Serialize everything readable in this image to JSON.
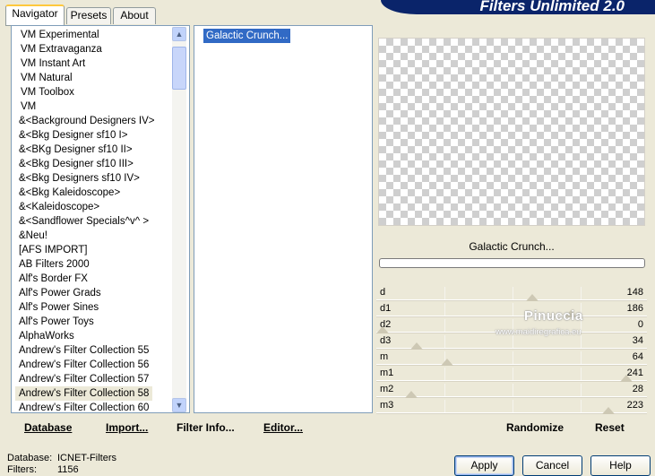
{
  "banner": {
    "title": "Filters Unlimited 2.0"
  },
  "tabs": [
    {
      "label": "Navigator",
      "active": true
    },
    {
      "label": "Presets",
      "active": false
    },
    {
      "label": "About",
      "active": false
    }
  ],
  "categories": [
    "VM Experimental",
    "VM Extravaganza",
    "VM Instant Art",
    "VM Natural",
    "VM Toolbox",
    "VM",
    "&<Background Designers IV>",
    "&<Bkg Designer sf10 I>",
    "&<BKg Designer sf10 II>",
    "&<Bkg Designer sf10 III>",
    "&<Bkg Designers sf10 IV>",
    "&<Bkg Kaleidoscope>",
    "&<Kaleidoscope>",
    "&<Sandflower Specials^v^ >",
    "&Neu!",
    "[AFS IMPORT]",
    "AB Filters 2000",
    "Alf's Border FX",
    "Alf's Power Grads",
    "Alf's Power Sines",
    "Alf's Power Toys",
    "AlphaWorks",
    "Andrew's Filter Collection 55",
    "Andrew's Filter Collection 56",
    "Andrew's Filter Collection 57",
    "Andrew's Filter Collection 58",
    "Andrew's Filter Collection 60"
  ],
  "selected_category": "Andrew's Filter Collection 58",
  "filters": [
    "Galactic Crunch..."
  ],
  "left_buttons": {
    "database": "Database",
    "import": "Import...",
    "filter_info": "Filter Info...",
    "editor": "Editor..."
  },
  "preview": {
    "filter_name": "Galactic Crunch..."
  },
  "params": [
    {
      "label": "d",
      "value": "148",
      "level": 148
    },
    {
      "label": "d1",
      "value": "186",
      "level": 186
    },
    {
      "label": "d2",
      "value": "0",
      "level": 0
    },
    {
      "label": "d3",
      "value": "34",
      "level": 34
    },
    {
      "label": "m",
      "value": "64",
      "level": 64
    },
    {
      "label": "m1",
      "value": "241",
      "level": 241
    },
    {
      "label": "m2",
      "value": "28",
      "level": 28
    },
    {
      "label": "m3",
      "value": "223",
      "level": 223
    }
  ],
  "watermark": {
    "name": "Pinuccia",
    "url": "www.maidiregrafica.eu"
  },
  "right_buttons": {
    "randomize": "Randomize",
    "reset": "Reset"
  },
  "status": {
    "database_label": "Database:",
    "database_value": "ICNET-Filters",
    "filters_label": "Filters:",
    "filters_value": "1156"
  },
  "dialog_buttons": {
    "apply": "Apply",
    "cancel": "Cancel",
    "help": "Help"
  }
}
